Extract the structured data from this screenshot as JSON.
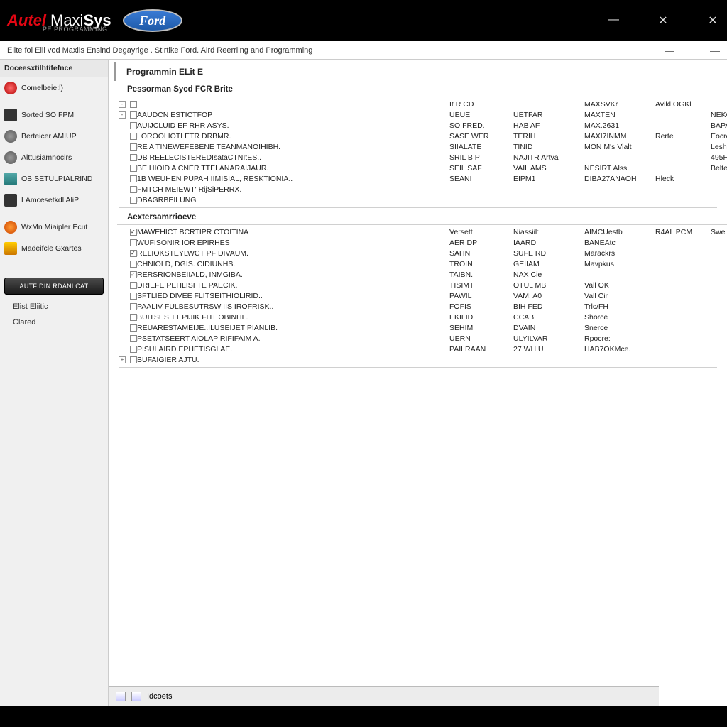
{
  "titlebar": {
    "brand_a": "Autel",
    "brand_b_1": "Maxi",
    "brand_b_2": "Sys",
    "sub": "PE PROGRAMMING",
    "ford": "Ford",
    "min": "—",
    "close1": "✕",
    "close2": "✕"
  },
  "subbar": {
    "breadcrumb": "Elite fol Elil vod Maxils Ensind Degayrige . Stirtike Ford. Aird Reerrling and Programming",
    "min": "—",
    "dash": "—"
  },
  "sidebar": {
    "header": "Doceesxtilhtifefnce",
    "items": [
      {
        "label": "Comelbeie:l)",
        "icon": "ic-red"
      },
      {
        "label": "Sorted SO FPM",
        "icon": "ic-dark"
      },
      {
        "label": "Berteicer AMIUP",
        "icon": "ic-grey"
      },
      {
        "label": "Alttusiamnoclrs",
        "icon": "ic-grey"
      },
      {
        "label": "OB SETULPIALRIND",
        "icon": "ic-teal"
      },
      {
        "label": "LAmcesetkdl AliP",
        "icon": "ic-dark"
      }
    ],
    "items2": [
      {
        "label": "WxMn Miaipler Ecut",
        "icon": "ic-orange"
      },
      {
        "label": "Madeifcle Gxartes",
        "icon": "ic-warn"
      }
    ],
    "button": "AUTF DIN RDANLCAT",
    "link1": "Elist Eliitic",
    "link2": "Clared"
  },
  "content": {
    "title": "Programmin ELit E",
    "section1": {
      "title": "Pessorman Sycd FCR Brite",
      "head": [
        "",
        "It R CD",
        "",
        "MAXSVKr",
        "Avikl OGKl",
        ""
      ],
      "rows": [
        {
          "cb": false,
          "tree": "-",
          "c1": "AAUDCN ESTICTFOP",
          "c2": "UEUE",
          "c3": "UETFAR",
          "c4": "MAXTEN",
          "c5": "",
          "c6": "NEKOK"
        },
        {
          "cb": false,
          "c1": "AUIJCLUID EF RHR ASYS.",
          "c2": "SO FRED.",
          "c3": "HAB AF",
          "c4": "MAX.2631",
          "c5": "",
          "c6": "BAPAP"
        },
        {
          "cb": false,
          "c1": "I OROOLIOTLETR DRBMR.",
          "c2": "SASE WER",
          "c3": "TERIH",
          "c4": "MAXI7INMM",
          "c5": "Rerte",
          "c6": "Eocrec"
        },
        {
          "cb": false,
          "c1": "RE A TINEWEFEBENE TEANMANOIHIBH.",
          "c2": "SIIALATE",
          "c3": "TINID",
          "c4": "MON M's Vialt",
          "c5": "",
          "c6": "Leshk"
        },
        {
          "cb": false,
          "c1": "DB REELECISTEREDIsataCTNItES..",
          "c2": "SRIL B P",
          "c3": "NAJITR Artva",
          "c4": "",
          "c5": "",
          "c6": "495H"
        },
        {
          "cb": false,
          "c1": "BE HIOID A CNER TTELANARAIJAUR.",
          "c2": "SEIL SAF",
          "c3": "VAIL AMS",
          "c4": "NESIRT Alss.",
          "c5": "",
          "c6": "Beltena e"
        },
        {
          "cb": false,
          "c1": "1B WEUHEN PUPAH IIMISIAL, RESKTIONIA..",
          "c2": "SEANI",
          "c3": "EIPM1",
          "c4": "DIBA27ANAOH",
          "c5": "Hleck",
          "c6": ""
        },
        {
          "cb": false,
          "c1": "FMTCH MEIEWT' RijSiPERRX.",
          "c2": "",
          "c3": "",
          "c4": "",
          "c5": "",
          "c6": ""
        },
        {
          "cb": false,
          "c1": "DBAGRBEILUNG",
          "c2": "",
          "c3": "",
          "c4": "",
          "c5": "",
          "c6": ""
        }
      ]
    },
    "section2": {
      "title": "Aextersamrrioeve",
      "rows": [
        {
          "cb": true,
          "c1": "MAWEHICT BCRTIPR CTOITINA",
          "c2": "Versett",
          "c3": "Niassiil:",
          "c4": "AIMCUestb",
          "c5": "R4AL PCM",
          "c6": "Swelbas:"
        },
        {
          "cb": false,
          "c1": "WUFISONIR IOR EPIRHES",
          "c2": "AER DP",
          "c3": "IAARD",
          "c4": "BANEAtc",
          "c5": "",
          "c6": ""
        },
        {
          "cb": true,
          "c1": "RELIOKSTEYLWCT PF DIVAUM.",
          "c2": "SAHN",
          "c3": "SUFE RD",
          "c4": "Marackrs",
          "c5": "",
          "c6": ""
        },
        {
          "cb": false,
          "c1": "CHNIOLD, DGIS. CIDIUNHS.",
          "c2": "TROIN",
          "c3": "GEIIAM",
          "c4": "Mavpkus",
          "c5": "",
          "c6": ""
        },
        {
          "cb": true,
          "c1": "RERSRIONBEIIALD, INMGIBA.",
          "c2": "TAIBN.",
          "c3": "NAX Cie",
          "c4": "",
          "c5": "",
          "c6": ""
        },
        {
          "cb": false,
          "c1": "DRIEFE PEHLISI TE PAECIK.",
          "c2": "TISIMT",
          "c3": "OTUL MB",
          "c4": "Vall OK",
          "c5": "",
          "c6": ""
        },
        {
          "cb": false,
          "c1": "SFTLIED DIVEE FLITSEITHIOLIRID..",
          "c2": "PAWIL",
          "c3": "VAM: A0",
          "c4": "Vall Cir",
          "c5": "",
          "c6": ""
        },
        {
          "cb": false,
          "c1": "PAALIV FULBESUTRSW IIS IROFRISK..",
          "c2": "FOFIS",
          "c3": "BIH FED",
          "c4": "Trlc/FH",
          "c5": "",
          "c6": ""
        },
        {
          "cb": false,
          "c1": "BUITSES TT PIJIK FHT OBINHL.",
          "c2": "EKILID",
          "c3": "CCAB",
          "c4": "Shorce",
          "c5": "",
          "c6": ""
        },
        {
          "cb": false,
          "c1": "REUARESTAMEIJE..ILUSEIJET PIANLIB.",
          "c2": "SEHIM",
          "c3": "DVAIN",
          "c4": "Snerce",
          "c5": "",
          "c6": ""
        },
        {
          "cb": false,
          "c1": "PSETATSEERT AIOLAP RIFIFAIM A.",
          "c2": "UERN",
          "c3": "ULYILVAR",
          "c4": "Rpocre:",
          "c5": "",
          "c6": ""
        },
        {
          "cb": false,
          "c1": "PISULAIRD.EPHETISGLAE.",
          "c2": "PAILRAAN",
          "c3": "27 WH U",
          "c4": "HAB7OKMce.",
          "c5": "",
          "c6": ""
        },
        {
          "cb": false,
          "tree": "+",
          "c1": "BUFAIGIER AJTU.",
          "c2": "",
          "c3": "",
          "c4": "",
          "c5": "",
          "c6": ""
        }
      ]
    }
  },
  "statusbar": {
    "label": "Idcoets"
  }
}
